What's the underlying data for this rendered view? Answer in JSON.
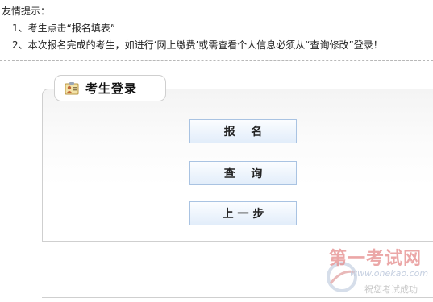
{
  "tips": {
    "title": "友情提示：",
    "lines": [
      "1、考生点击“报名填表”",
      "2、本次报名完成的考生，如进行‘网上缴费’或需查看个人信息必须从“查询修改”登录！"
    ]
  },
  "panel": {
    "title": "考生登录",
    "icon": "id-card-icon"
  },
  "buttons": {
    "register": "报    名",
    "query": "查    询",
    "back": "上 一 步"
  },
  "watermark": {
    "name": "第一考试网",
    "domain": "www.onekao.com",
    "slogan": "祝您考试成功"
  }
}
